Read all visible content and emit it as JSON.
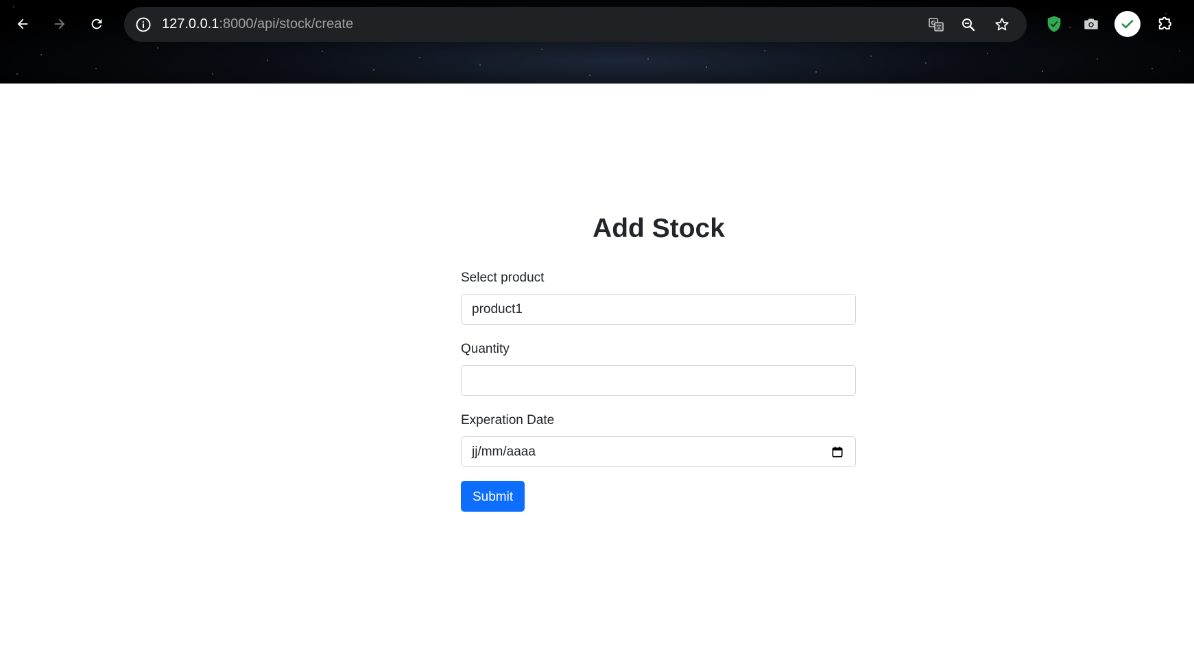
{
  "browser": {
    "url_host": "127.0.0.1",
    "url_path": ":8000/api/stock/create",
    "icons": {
      "back": "back-arrow-icon",
      "forward": "forward-arrow-icon",
      "reload": "reload-icon",
      "site_info": "info-icon",
      "translate": "translate-icon",
      "zoom": "zoom-icon",
      "bookmark": "star-icon",
      "shield_extension": "shield-icon",
      "camera_extension": "camera-icon",
      "check_extension": "check-icon",
      "extensions": "puzzle-icon"
    },
    "colors": {
      "omnibox_bg": "#202124",
      "url_host": "#ffffff",
      "url_path": "#9aa0a6",
      "shield": "#34a853"
    }
  },
  "page": {
    "title": "Add Stock",
    "form": {
      "product_label": "Select product",
      "product_value": "product1",
      "quantity_label": "Quantity",
      "quantity_value": "",
      "expiration_label": "Experation Date",
      "expiration_placeholder": "jj/mm/aaaa",
      "submit_label": "Submit"
    },
    "colors": {
      "primary": "#0d6efd",
      "text": "#212529",
      "border": "#ced4da"
    }
  }
}
